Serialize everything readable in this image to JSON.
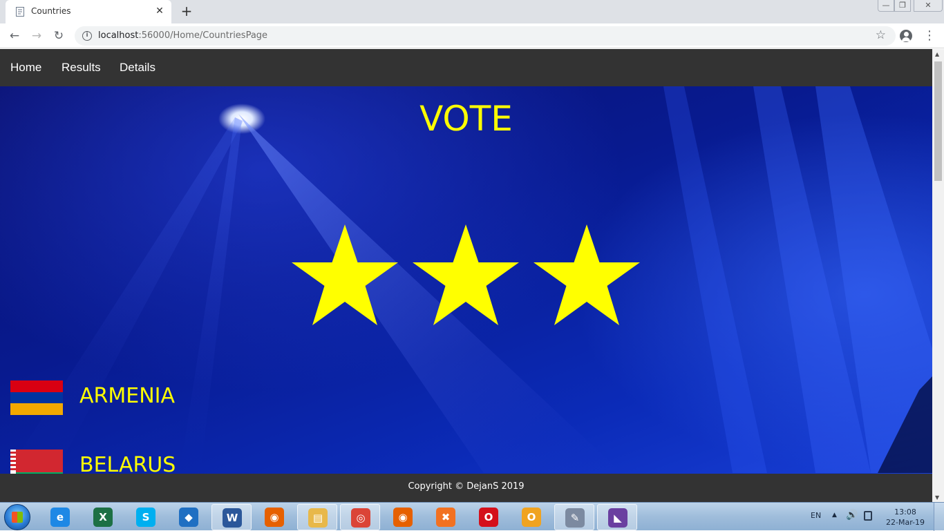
{
  "browser": {
    "tab_title": "Countries",
    "tab_close": "✕",
    "new_tab": "+",
    "url_host": "localhost",
    "url_path": ":56000/Home/CountriesPage",
    "window_controls": {
      "minimize": "—",
      "maximize": "❐",
      "close": "✕"
    }
  },
  "nav": {
    "home": "Home",
    "results": "Results",
    "details": "Details"
  },
  "hero": {
    "title": "VOTE",
    "stars": 3
  },
  "countries": [
    {
      "name": "ARMENIA",
      "flag_colors": [
        "#d90012",
        "#0033a0",
        "#f2a800"
      ]
    },
    {
      "name": "BELARUS",
      "flag_colors": [
        "#d22730",
        "#00af66"
      ]
    }
  ],
  "footer": {
    "copyright": "Copyright © DejanS 2019"
  },
  "taskbar": {
    "apps": [
      {
        "name": "internet-explorer",
        "label": "e",
        "color": "#1e88e5",
        "active": false
      },
      {
        "name": "excel",
        "label": "X",
        "color": "#1d7044",
        "active": false
      },
      {
        "name": "skype",
        "label": "S",
        "color": "#00aff0",
        "active": false
      },
      {
        "name": "vscode",
        "label": "◆",
        "color": "#1f6fc2",
        "active": false
      },
      {
        "name": "word",
        "label": "W",
        "color": "#2b579a",
        "active": true
      },
      {
        "name": "firefox",
        "label": "◉",
        "color": "#e66000",
        "active": false
      },
      {
        "name": "file-explorer",
        "label": "▤",
        "color": "#e8b84a",
        "active": true
      },
      {
        "name": "chrome",
        "label": "◎",
        "color": "#db4437",
        "active": true
      },
      {
        "name": "firefox-2",
        "label": "◉",
        "color": "#e66000",
        "active": false
      },
      {
        "name": "xampp",
        "label": "✖",
        "color": "#f27121",
        "active": false
      },
      {
        "name": "opera",
        "label": "O",
        "color": "#d4101b",
        "active": false
      },
      {
        "name": "outlook",
        "label": "O",
        "color": "#f0a320",
        "active": false
      },
      {
        "name": "tools",
        "label": "✎",
        "color": "#7c8aa0",
        "active": true
      },
      {
        "name": "visual-studio",
        "label": "◣",
        "color": "#6a3fa0",
        "active": true
      }
    ],
    "language": "EN",
    "time": "13:08",
    "date": "22-Mar-19"
  }
}
